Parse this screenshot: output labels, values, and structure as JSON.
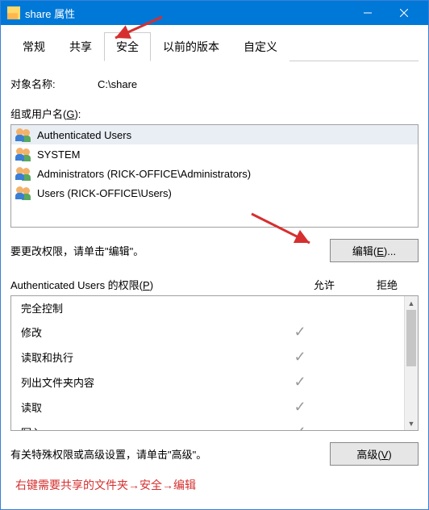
{
  "window": {
    "title": "share 属性"
  },
  "tabs": [
    {
      "label": "常规"
    },
    {
      "label": "共享"
    },
    {
      "label": "安全",
      "active": true
    },
    {
      "label": "以前的版本"
    },
    {
      "label": "自定义"
    }
  ],
  "object": {
    "label": "对象名称:",
    "value": "C:\\share"
  },
  "groups": {
    "label_prefix": "组或用户名(",
    "label_hotkey": "G",
    "label_suffix": "):",
    "items": [
      {
        "name": "Authenticated Users"
      },
      {
        "name": "SYSTEM"
      },
      {
        "name": "Administrators (RICK-OFFICE\\Administrators)"
      },
      {
        "name": "Users (RICK-OFFICE\\Users)"
      }
    ]
  },
  "edit": {
    "hint": "要更改权限，请单击\"编辑\"。",
    "button_prefix": "编辑(",
    "button_hotkey": "E",
    "button_suffix": ")..."
  },
  "permissions": {
    "header_prefix": "Authenticated Users 的权限(",
    "header_hotkey": "P",
    "header_suffix": ")",
    "allow": "允许",
    "deny": "拒绝",
    "rows": [
      {
        "name": "完全控制",
        "allow": false,
        "deny": false
      },
      {
        "name": "修改",
        "allow": true,
        "deny": false
      },
      {
        "name": "读取和执行",
        "allow": true,
        "deny": false
      },
      {
        "name": "列出文件夹内容",
        "allow": true,
        "deny": false
      },
      {
        "name": "读取",
        "allow": true,
        "deny": false
      },
      {
        "name": "写入",
        "allow": true,
        "deny": false
      }
    ]
  },
  "advanced": {
    "hint": "有关特殊权限或高级设置，请单击\"高级\"。",
    "button_prefix": "高级(",
    "button_hotkey": "V",
    "button_suffix": ")"
  },
  "annotation": "右键需要共享的文件夹→安全→编辑"
}
